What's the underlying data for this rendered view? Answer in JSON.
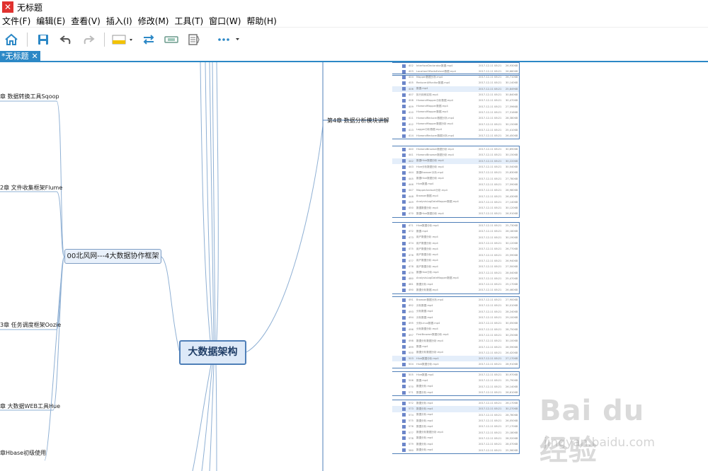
{
  "window": {
    "title": "无标题"
  },
  "menu": [
    "文件(F)",
    "编辑(E)",
    "查看(V)",
    "插入(I)",
    "修改(M)",
    "工具(T)",
    "窗口(W)",
    "帮助(H)"
  ],
  "toolbar": {
    "icons": [
      "home-icon",
      "save-icon",
      "undo-icon",
      "redo-icon",
      "topic-style-icon",
      "swap-icon",
      "relationship-icon",
      "outline-icon",
      "more-icon"
    ]
  },
  "tab": {
    "label": "*无标题",
    "close": "✕"
  },
  "mindmap": {
    "central": "大数据架构",
    "main_topic": "00北风网---4大数据协作框架",
    "left_nodes": [
      "章 数据转换工具Sqoop",
      "2章 文件收集框架Flume",
      "3章 任务调度框架Oozie",
      "章 大数据WEB工具Hue",
      "章Hbase初级使用"
    ],
    "right_node": "第4章 数据分析模块讲解"
  },
  "files": [
    {
      "n": "402",
      "name": "InterfaceDeclarator数据.mp4",
      "date": "2017-12-11 08:21",
      "size": "26,930KB"
    },
    {
      "n": "403",
      "name": "LocationOffsetsExtent数据.mp4",
      "date": "2017-12-11 08:21",
      "size": "26,680KB"
    },
    {
      "n": "404",
      "name": "Mapper数据分析.mp4",
      "date": "2017-12-11 08:21",
      "size": "26,710KB"
    },
    {
      "n": "405",
      "name": "ReducerAMonitor数据.mp4",
      "date": "2017-12-11 08:21",
      "size": "30,140KB"
    },
    {
      "n": "406",
      "name": "数据.mp4",
      "date": "2017-12-11 08:21",
      "size": "25,849KB",
      "sel": true
    },
    {
      "n": "407",
      "name": "执行用例实现.mp4",
      "date": "2017-12-11 08:21",
      "size": "30,840KB"
    },
    {
      "n": "408",
      "name": "HiveandMapper分析数据.mp4",
      "date": "2017-12-11 08:21",
      "size": "30,470KB"
    },
    {
      "n": "409",
      "name": "HiveandMapper数据.mp4",
      "date": "2017-12-11 08:21",
      "size": "27,596KB"
    },
    {
      "n": "410",
      "name": "HiveandMapper数据.mp4",
      "date": "2017-12-11 08:21",
      "size": "27,316KB"
    },
    {
      "n": "411",
      "name": "HiveandReducer数据分析.mp4",
      "date": "2017-12-11 08:21",
      "size": "28,380KB"
    },
    {
      "n": "412",
      "name": "HiveandMapper数据分析.mp4",
      "date": "2017-12-11 08:21",
      "size": "30,150KB"
    },
    {
      "n": "413",
      "name": "Logger分析数据.mp4",
      "date": "2017-12-11 08:21",
      "size": "25,410KB"
    },
    {
      "n": "414",
      "name": "HiveandReducer数据分析.mp4",
      "date": "2017-12-11 08:21",
      "size": "26,450KB"
    },
    {
      "n": "440",
      "name": "HiveandBrowser数据分析.mp4",
      "date": "2017-12-11 08:21",
      "size": "30,890KB"
    },
    {
      "n": "441",
      "name": "HiveandBrowser数据分析.mp4",
      "date": "2017-12-11 08:21",
      "size": "30,150KB"
    },
    {
      "n": "442",
      "name": "数据Hive数据分析.mp4",
      "date": "2017-12-11 08:21",
      "size": "30,220KB",
      "sel": true
    },
    {
      "n": "443",
      "name": "Hive分析数据分析.mp4",
      "date": "2017-12-11 08:21",
      "size": "30,540KB"
    },
    {
      "n": "444",
      "name": "数据Browser分析.mp4",
      "date": "2017-12-11 08:21",
      "size": "25,630KB"
    },
    {
      "n": "445",
      "name": "数据Hive数据分析.mp4",
      "date": "2017-12-11 08:21",
      "size": "27,780KB"
    },
    {
      "n": "446",
      "name": "Hive数据.mp4",
      "date": "2017-12-11 08:21",
      "size": "27,590KB"
    },
    {
      "n": "447",
      "name": "MapperAndsort分析.mp4",
      "date": "2017-12-11 08:21",
      "size": "26,980KB"
    },
    {
      "n": "448",
      "name": "Browser数据.mp4",
      "date": "2017-12-11 08:21",
      "size": "26,430KB"
    },
    {
      "n": "449",
      "name": "AnalysisLogDataMapper数据.mp4",
      "date": "2017-12-11 08:21",
      "size": "27,140KB"
    },
    {
      "n": "450",
      "name": "数据数据分析.mp4",
      "date": "2017-12-11 08:21",
      "size": "30,120KB"
    },
    {
      "n": "470",
      "name": "数据Hive数据分析.mp4",
      "date": "2017-12-11 08:21",
      "size": "26,910KB"
    },
    {
      "n": "471",
      "name": "Hive数据分析.mp4",
      "date": "2017-12-11 08:21",
      "size": "25,730KB"
    },
    {
      "n": "472",
      "name": "数据.mp4",
      "date": "2017-12-11 08:21",
      "size": "26,180KB"
    },
    {
      "n": "473",
      "name": "用户数据分析.mp4",
      "date": "2017-12-11 08:21",
      "size": "30,190KB"
    },
    {
      "n": "474",
      "name": "用户数据分析.mp4",
      "date": "2017-12-11 08:21",
      "size": "30,120KB"
    },
    {
      "n": "475",
      "name": "用户数据分析.mp4",
      "date": "2017-12-11 08:21",
      "size": "26,770KB"
    },
    {
      "n": "476",
      "name": "用户数据分析.mp4",
      "date": "2017-12-11 08:21",
      "size": "25,590KB"
    },
    {
      "n": "477",
      "name": "用户数据分析.mp4",
      "date": "2017-12-11 08:21",
      "size": "26,940KB"
    },
    {
      "n": "478",
      "name": "用户数据分析.mp4",
      "date": "2017-12-11 08:21",
      "size": "27,500KB"
    },
    {
      "n": "479",
      "name": "数据Hive分析.mp4",
      "date": "2017-12-11 08:21",
      "size": "28,040KB"
    },
    {
      "n": "480",
      "name": "AnalysisLogDataMapper数据.mp4",
      "date": "2017-12-11 08:21",
      "size": "25,470KB"
    },
    {
      "n": "481",
      "name": "数据分析.mp4",
      "date": "2017-12-11 08:21",
      "size": "25,170KB"
    },
    {
      "n": "490",
      "name": "数据分析数据.mp4",
      "date": "2017-12-11 08:21",
      "size": "26,460KB"
    },
    {
      "n": "491",
      "name": "Browser数据分析.mp4",
      "date": "2017-12-11 08:21",
      "size": "27,900KB"
    },
    {
      "n": "492",
      "name": "分析数据.mp4",
      "date": "2017-12-11 08:21",
      "size": "30,010KB"
    },
    {
      "n": "493",
      "name": "分析数据.mp4",
      "date": "2017-12-11 08:21",
      "size": "28,240KB"
    },
    {
      "n": "494",
      "name": "分析数据.mp4",
      "date": "2017-12-11 08:21",
      "size": "29,100KB"
    },
    {
      "n": "495",
      "name": "分析Linux数据.mp4",
      "date": "2017-12-11 08:21",
      "size": "30,050KB"
    },
    {
      "n": "496",
      "name": "分析数据分析.mp4",
      "date": "2017-12-11 08:21",
      "size": "28,750KB"
    },
    {
      "n": "497",
      "name": "FirstBrowser数据分析.mp4",
      "date": "2017-12-11 08:21",
      "size": "30,250KB"
    },
    {
      "n": "498",
      "name": "数据分析数据分析.mp4",
      "date": "2017-12-11 08:21",
      "size": "30,100KB"
    },
    {
      "n": "499",
      "name": "数据.mp4",
      "date": "2017-12-11 08:21",
      "size": "26,590KB"
    },
    {
      "n": "500",
      "name": "数据分析数据分析.mp4",
      "date": "2017-12-11 08:21",
      "size": "26,420KB"
    },
    {
      "n": "503",
      "name": "Hive数据分析.mp4",
      "date": "2017-12-11 08:21",
      "size": "27,170KB",
      "sel": true
    },
    {
      "n": "504",
      "name": "Hive数据分析.mp4",
      "date": "2017-12-11 08:21",
      "size": "28,910KB"
    },
    {
      "n": "505",
      "name": "Hive数据.mp4",
      "date": "2017-12-11 08:21",
      "size": "30,970KB"
    },
    {
      "n": "506",
      "name": "数据.mp4",
      "date": "2017-12-11 08:21",
      "size": "25,790KB"
    },
    {
      "n": "570",
      "name": "数据分析.mp4",
      "date": "2017-12-11 08:21",
      "size": "26,140KB"
    },
    {
      "n": "571",
      "name": "数据分析.mp4",
      "date": "2017-12-11 08:21",
      "size": "26,610KB"
    },
    {
      "n": "572",
      "name": "数据分析.mp4",
      "date": "2017-12-11 08:21",
      "size": "26,170KB"
    },
    {
      "n": "573",
      "name": "数据分析.mp4",
      "date": "2017-12-11 08:21",
      "size": "30,270KB",
      "sel": true
    },
    {
      "n": "574",
      "name": "数据分析.mp4",
      "date": "2017-12-11 08:21",
      "size": "28,780KB"
    },
    {
      "n": "575",
      "name": "数据分析.mp4",
      "date": "2017-12-11 08:21",
      "size": "26,050KB"
    },
    {
      "n": "576",
      "name": "数据分析.mp4",
      "date": "2017-12-11 08:21",
      "size": "27,170KB"
    },
    {
      "n": "577",
      "name": "数据分析数据分析.mp4",
      "date": "2017-12-11 08:21",
      "size": "25,180KB"
    },
    {
      "n": "578",
      "name": "数据分析.mp4",
      "date": "2017-12-11 08:21",
      "size": "28,520KB"
    },
    {
      "n": "579",
      "name": "数据分析.mp4",
      "date": "2017-12-11 08:21",
      "size": "28,070KB"
    },
    {
      "n": "580",
      "name": "数据分析.mp4",
      "date": "2017-12-11 08:21",
      "size": "25,560KB"
    }
  ],
  "file_groups": [
    2,
    11,
    12,
    12,
    12,
    4,
    11
  ],
  "watermark": {
    "logo": "Bai du 经验",
    "url": "jingyan.baidu.com"
  },
  "colors": {
    "accent": "#2c88c6",
    "line": "#4f7fb8",
    "logo": "#e0322f"
  }
}
